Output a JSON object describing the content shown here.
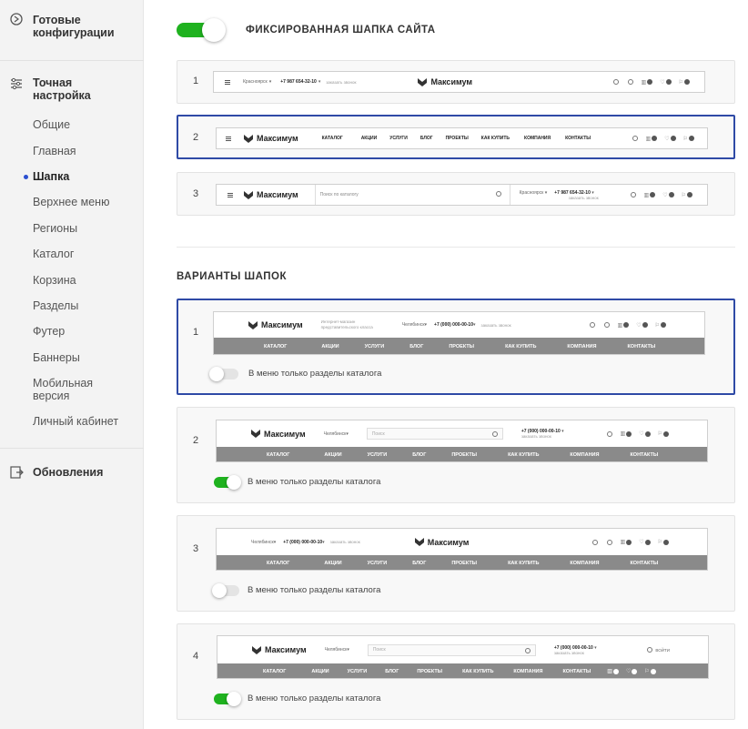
{
  "sidebar": {
    "ready_configs": "Готовые\nконфигурации",
    "fine_tuning": "Точная\nнастройка",
    "items": [
      "Общие",
      "Главная",
      "Шапка",
      "Верхнее меню",
      "Регионы",
      "Каталог",
      "Корзина",
      "Разделы",
      "Футер",
      "Баннеры",
      "Мобильная\nверсия",
      "Личный кабинет"
    ],
    "active_item": "Шапка",
    "updates": "Обновления"
  },
  "fixed_header": {
    "label": "ФИКСИРОВАННАЯ ШАПКА САЙТА",
    "enabled": true
  },
  "fixed_variants": [
    {
      "num": "1",
      "city": "Красноярск",
      "phone": "+7 987 654-32-10",
      "callback": "заказать звонок",
      "logo": "Максимум"
    },
    {
      "num": "2",
      "logo": "Максимум",
      "menu": [
        "КАТАЛОГ",
        "АКЦИИ",
        "УСЛУГИ",
        "БЛОГ",
        "ПРОЕКТЫ",
        "КАК КУПИТЬ",
        "КОМПАНИЯ",
        "КОНТАКТЫ"
      ]
    },
    {
      "num": "3",
      "logo": "Максимум",
      "search": "Поиск по каталогу",
      "city": "Красноярск",
      "phone": "+7 987 654-32-10",
      "callback": "заказать звонок"
    }
  ],
  "variants_title": "ВАРИАНТЫ ШАПОК",
  "header_variants": [
    {
      "num": "1",
      "logo": "Максимум",
      "tagline": "Интернет-магазин\nпредставительского класса",
      "city": "Челябинск",
      "phone": "+7 (000) 000-00-10",
      "callback": "заказать звонок",
      "menu": [
        "КАТАЛОГ",
        "АКЦИИ",
        "УСЛУГИ",
        "БЛОГ",
        "ПРОЕКТЫ",
        "КАК КУПИТЬ",
        "КОМПАНИЯ",
        "КОНТАКТЫ"
      ],
      "toggle_label": "В меню только разделы каталога",
      "toggle_on": false
    },
    {
      "num": "2",
      "logo": "Максимум",
      "city": "Челябинск",
      "search": "Поиск",
      "phone": "+7 (000) 000-00-10",
      "callback": "заказать звонок",
      "menu": [
        "КАТАЛОГ",
        "АКЦИИ",
        "УСЛУГИ",
        "БЛОГ",
        "ПРОЕКТЫ",
        "КАК КУПИТЬ",
        "КОМПАНИЯ",
        "КОНТАКТЫ"
      ],
      "toggle_label": "В меню только разделы каталога",
      "toggle_on": true
    },
    {
      "num": "3",
      "logo": "Максимум",
      "city": "Челябинск",
      "phone": "+7 (000) 000-00-10",
      "callback": "заказать звонок",
      "menu": [
        "КАТАЛОГ",
        "АКЦИИ",
        "УСЛУГИ",
        "БЛОГ",
        "ПРОЕКТЫ",
        "КАК КУПИТЬ",
        "КОМПАНИЯ",
        "КОНТАКТЫ"
      ],
      "toggle_label": "В меню только разделы каталога",
      "toggle_on": false
    },
    {
      "num": "4",
      "logo": "Максимум",
      "city": "Челябинск",
      "search": "Поиск",
      "phone": "+7 (000) 000-00-10",
      "callback": "заказать звонок",
      "login": "ВОЙТИ",
      "menu": [
        "КАТАЛОГ",
        "АКЦИИ",
        "УСЛУГИ",
        "БЛОГ",
        "ПРОЕКТЫ",
        "КАК КУПИТЬ",
        "КОМПАНИЯ",
        "КОНТАКТЫ"
      ],
      "toggle_label": "В меню только разделы каталога",
      "toggle_on": true
    }
  ],
  "colors": {
    "accent": "#1fb21f",
    "selected_border": "#2f4aa6",
    "nav_bg": "#8a8a8a",
    "active_dot": "#2b4fd0"
  }
}
